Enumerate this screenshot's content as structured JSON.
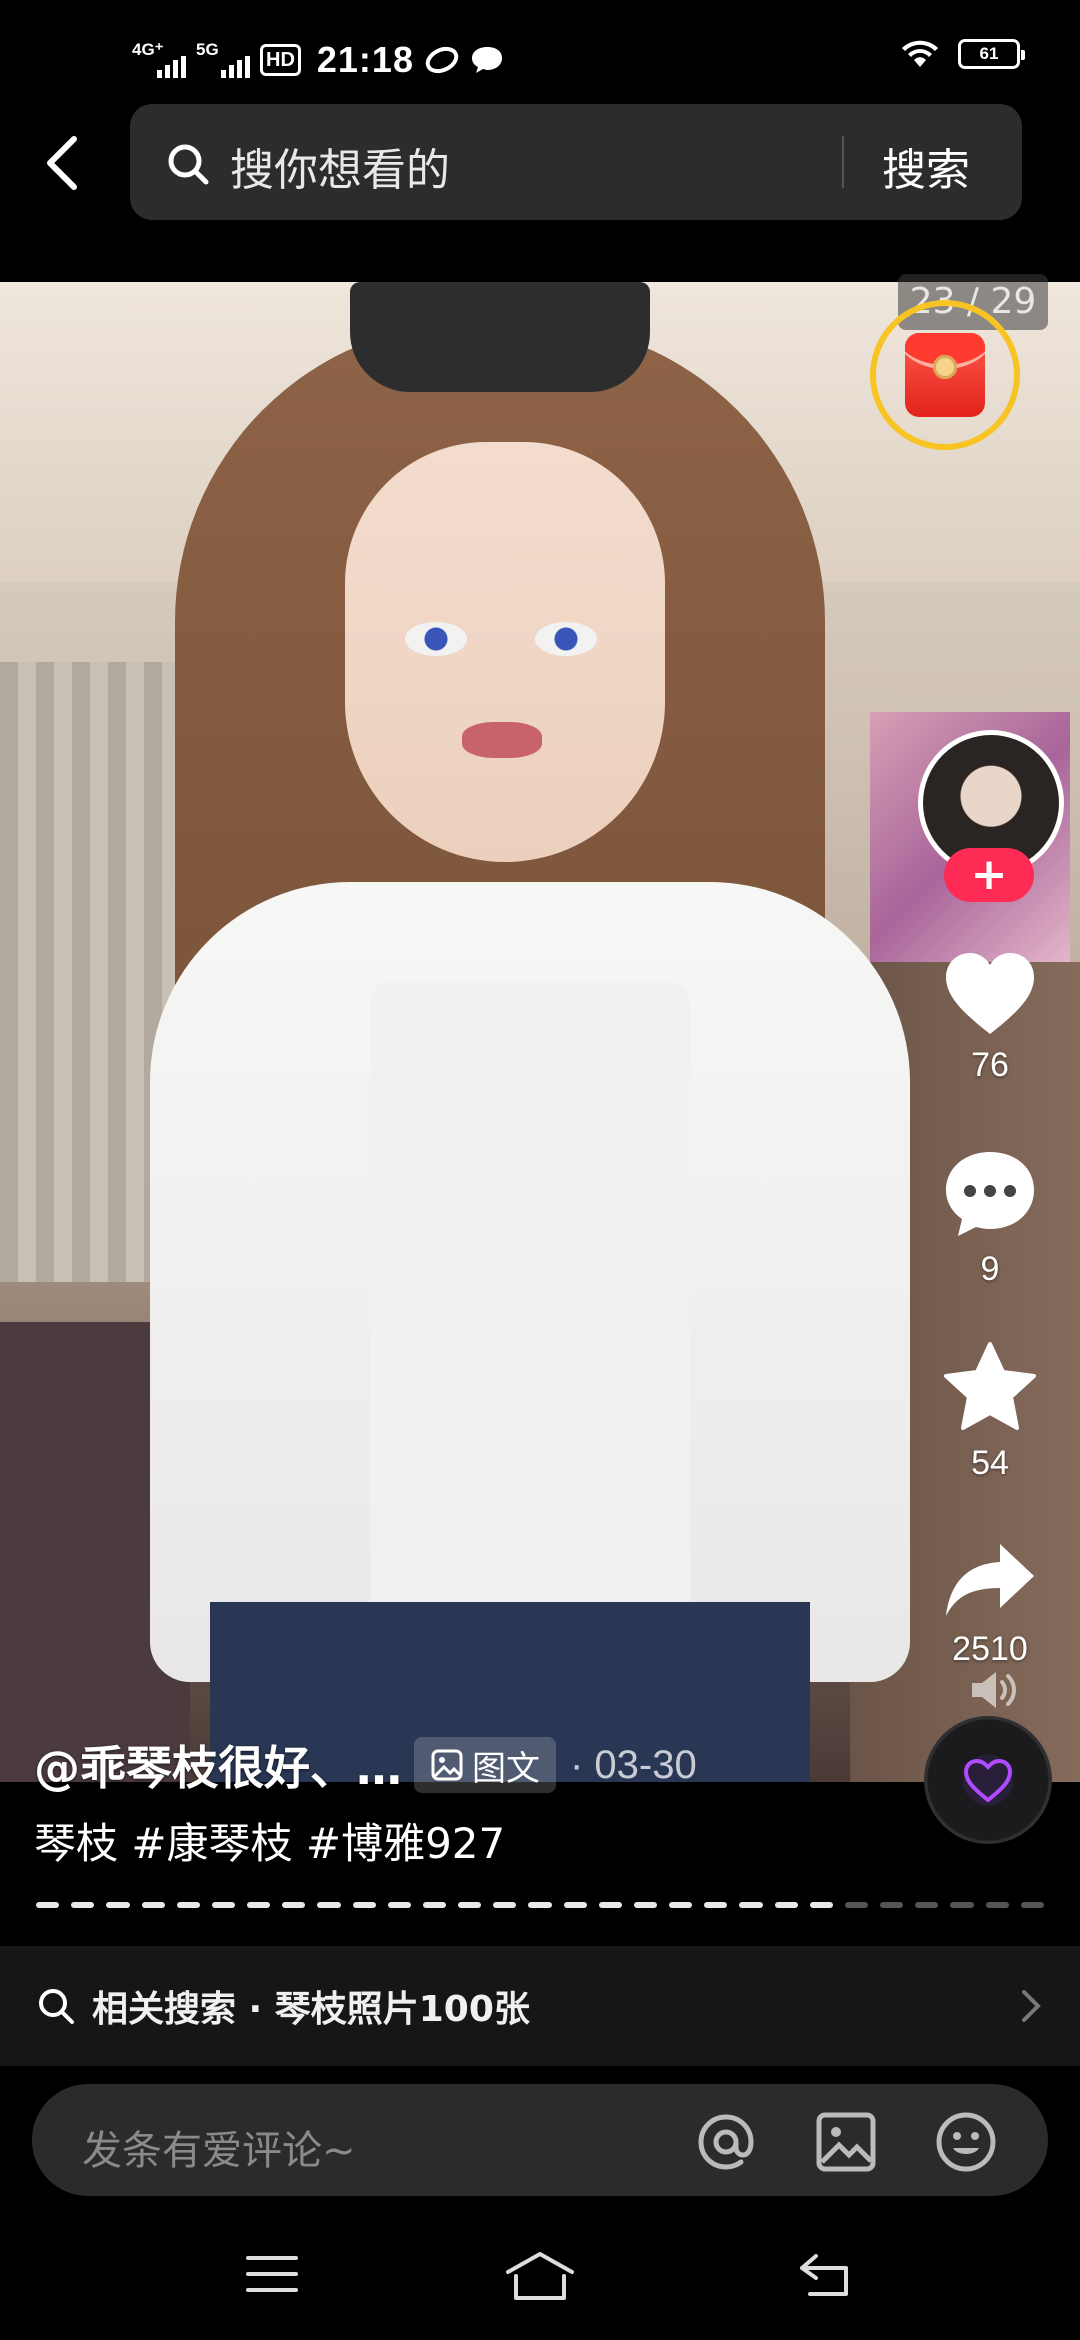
{
  "status_bar": {
    "network_1": "4G⁺",
    "network_2": "5G",
    "hd_label": "HD",
    "time": "21:18",
    "battery": "61"
  },
  "search": {
    "placeholder": "搜你想看的",
    "button": "搜索"
  },
  "media": {
    "counter": "23 / 29"
  },
  "actions": {
    "like_count": "76",
    "comment_count": "9",
    "favorite_count": "54",
    "share_count": "2510"
  },
  "caption": {
    "author": "@乖琴枝很好、…",
    "type_tag": "图文",
    "date": "· 03-30",
    "description": "琴枝 #康琴枝 #博雅927"
  },
  "progress": {
    "total_segments": 29,
    "current_segment": 23
  },
  "related": {
    "text": "相关搜索 · 琴枝照片100张"
  },
  "comment": {
    "placeholder": "发条有爱评论~"
  },
  "colors": {
    "accent_pink": "#fe2c55",
    "red_packet_ring": "#f7c424"
  }
}
